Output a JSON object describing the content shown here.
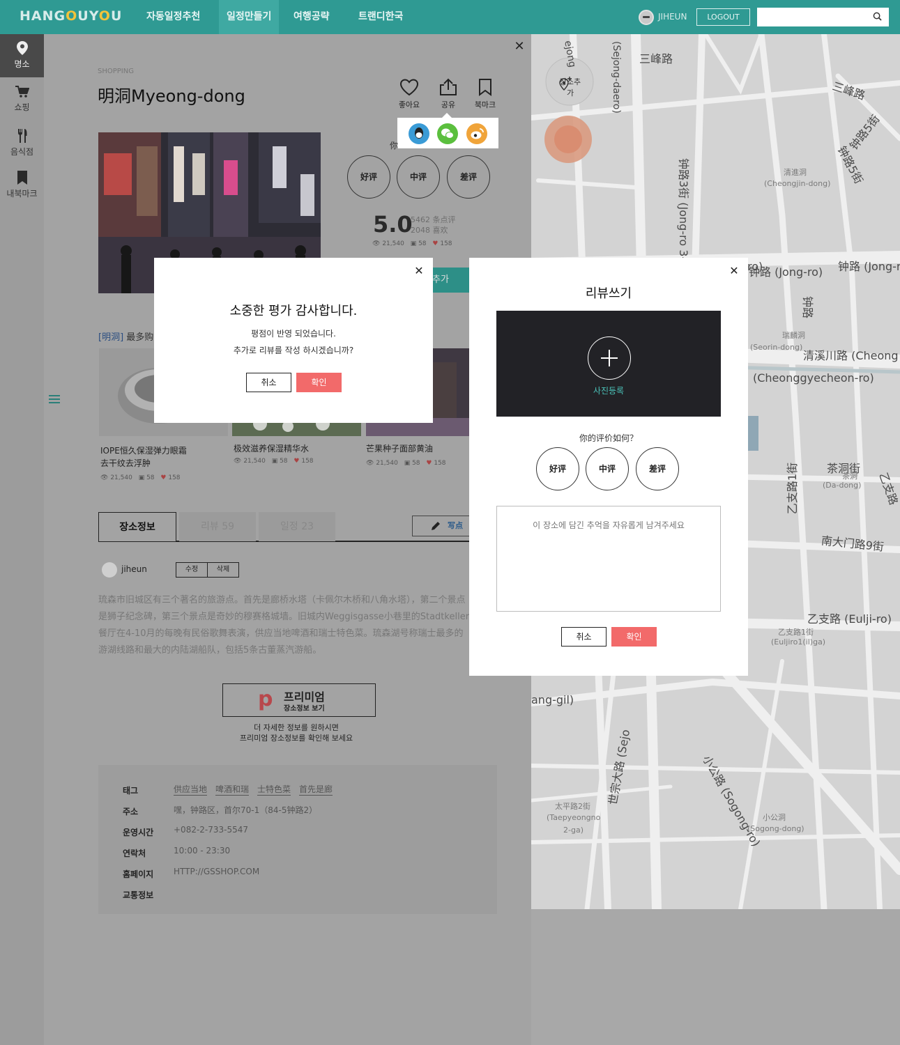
{
  "header": {
    "logo": "HANGOUYOU",
    "nav": [
      "자동일정추천",
      "일정만들기",
      "여행공략",
      "트랜디한국"
    ],
    "user": "JIHEUN",
    "logout": "LOGOUT",
    "search_placeholder": ""
  },
  "sidebar": {
    "items": [
      {
        "label": "명소",
        "icon": "map-pin-icon"
      },
      {
        "label": "쇼핑",
        "icon": "cart-icon"
      },
      {
        "label": "음식점",
        "icon": "fork-knife-icon"
      },
      {
        "label": "내북마크",
        "icon": "bookmark-icon"
      }
    ]
  },
  "place": {
    "category": "SHOPPING",
    "title": "明洞Myeong-dong",
    "actions": {
      "like": "좋아요",
      "share": "공유",
      "bookmark": "북마크"
    },
    "rating_question": "你",
    "rating_buttons": [
      "好评",
      "中评",
      "差评"
    ],
    "score": "5.0",
    "review_count": "5462 条点评",
    "like_count": "2048 喜欢",
    "stats": {
      "views": "21,540",
      "comments": "58",
      "likes": "158"
    },
    "add_button": "추가",
    "best_tag": "[明洞]",
    "best_label": "最多购"
  },
  "products": [
    {
      "name": "IOPE恒久保湿弹力眼霜\n去干纹去浮肿",
      "views": "21,540",
      "comments": "58",
      "likes": "158"
    },
    {
      "name": "极效滋养保湿精华水",
      "views": "21,540",
      "comments": "58",
      "likes": "158"
    },
    {
      "name": "芒果种子面部黄油",
      "views": "21,540",
      "comments": "58",
      "likes": "158"
    }
  ],
  "tabs": {
    "info": "장소정보",
    "review": "리뷰 59",
    "schedule": "일정 23",
    "write": "写点评"
  },
  "review": {
    "user": "jiheun",
    "edit": "수정",
    "delete": "삭제",
    "text": "琉森市旧城区有三个著名的旅游点。首先是廊桥水塔（卡佩尔木桥和八角水塔），第二个景点是狮子纪念碑，第三个景点是奇妙的穆赛格城墙。旧城内Weggisgasse小巷里的Stadtkeller餐厅在4-10月的每晚有民俗歌舞表演，供应当地啤酒和瑞士特色菜。琉森湖号称瑞士最多的游湖线路和最大的内陆湖船队，包括5条古董蒸汽游船。"
  },
  "premium": {
    "letter": "p",
    "title": "프리미엄",
    "subtitle": "장소정보  보기",
    "note1": "더 자세한 정보를 원하시면",
    "note2": "프리미엄 장소정보를 확인해 보세요"
  },
  "info": {
    "tag_label": "태그",
    "tags": [
      "供应当地",
      "啤酒和瑞",
      "士特色菜",
      "首先是廊"
    ],
    "address_label": "주소",
    "address": "嘿，钟路区，首尔70-1（84-5钟路2）",
    "hours_label": "운영시간",
    "hours": "+082-2-733-5547",
    "contact_label": "연락처",
    "contact": "10:00 - 23:30",
    "homepage_label": "홈페이지",
    "homepage": "HTTP://GSSHOP.COM",
    "transport_label": "교통정보"
  },
  "map": {
    "add_place": "장소추가",
    "labels": [
      "三峰路",
      "三峰路",
      "钟路5街",
      "钟路5街",
      "钟路3街 (Jong-ro 3-gil)",
      "清進洞",
      "(Cheongjin-dong)",
      "钟路 (Jong-ro)",
      "钟路 (Jong-r",
      "钟路",
      "瑞麟洞",
      "(Seorin-dong)",
      "清溪川路 (Cheong",
      "(Cheonggyecheon-ro)",
      "乙支路1街",
      "茶洞街",
      "茶洞",
      "(Da-dong)",
      "乙支路",
      "南大门路9街",
      "乙支路 (Eulji-ro)",
      "乙支路1街",
      "(Euljiro1(il)ga)",
      "ang-gil)",
      "世宗大路 (Sejo",
      "小公路 (Sogong-ro)",
      "太平路2街",
      "(Taepyeongno",
      "2-ga)",
      "小公洞",
      "(Sogong-dong)",
      "(Sejong-daero)",
      "ejong",
      "ro)"
    ]
  },
  "thanks_dialog": {
    "title": "소중한 평가 감사합니다.",
    "line1": "평점이 반영 되었습니다.",
    "line2": "추가로 리뷰를 작성 하시겠습니까?",
    "cancel": "취소",
    "ok": "확인"
  },
  "review_dialog": {
    "title": "리뷰쓰기",
    "photo": "사진등록",
    "question": "你的评价如何？",
    "buttons": [
      "好评",
      "中评",
      "差评"
    ],
    "placeholder": "이 장소에 담긴 추억을 자유롭게 남겨주세요",
    "cancel": "취소",
    "ok": "확인"
  }
}
